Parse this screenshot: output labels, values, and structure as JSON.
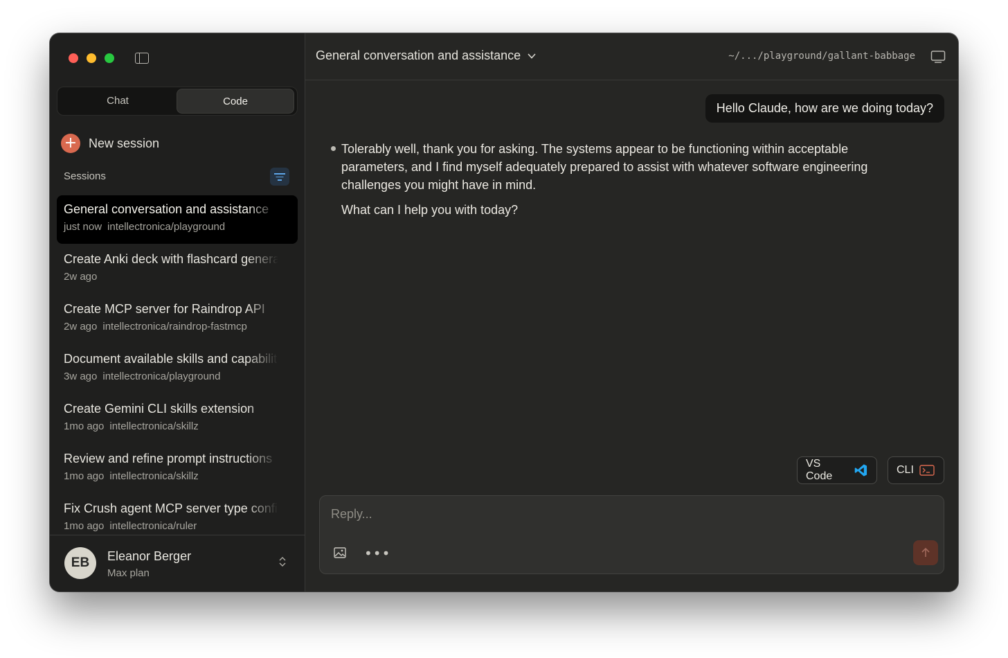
{
  "sidebar": {
    "mode_tabs": [
      {
        "label": "Chat",
        "active": false
      },
      {
        "label": "Code",
        "active": true
      }
    ],
    "new_session_label": "New session",
    "sessions_heading": "Sessions",
    "sessions": [
      {
        "title": "General conversation and assistance",
        "time": "just now",
        "repo": "intellectronica/playground",
        "active": true
      },
      {
        "title": "Create Anki deck with flashcard generator",
        "time": "2w ago",
        "repo": "",
        "active": false
      },
      {
        "title": "Create MCP server for Raindrop API",
        "time": "2w ago",
        "repo": "intellectronica/raindrop-fastmcp",
        "active": false
      },
      {
        "title": "Document available skills and capabilities",
        "time": "3w ago",
        "repo": "intellectronica/playground",
        "active": false
      },
      {
        "title": "Create Gemini CLI skills extension",
        "time": "1mo ago",
        "repo": "intellectronica/skillz",
        "active": false
      },
      {
        "title": "Review and refine prompt instructions",
        "time": "1mo ago",
        "repo": "intellectronica/skillz",
        "active": false
      },
      {
        "title": "Fix Crush agent MCP server type config",
        "time": "1mo ago",
        "repo": "intellectronica/ruler",
        "active": false
      }
    ],
    "profile": {
      "initials": "EB",
      "name": "Eleanor Berger",
      "plan": "Max plan"
    }
  },
  "header": {
    "title": "General conversation and assistance",
    "path": "~/.../playground/gallant-babbage"
  },
  "conversation": {
    "user_message": "Hello Claude, how are we doing today?",
    "assistant_paragraphs": [
      "Tolerably well, thank you for asking. The systems appear to be functioning within acceptable parameters, and I find myself adequately prepared to assist with whatever software engineering challenges you might have in mind.",
      "What can I help you with today?"
    ]
  },
  "actions": {
    "vscode_label": "VS Code",
    "cli_label": "CLI"
  },
  "composer": {
    "placeholder": "Reply...",
    "value": ""
  },
  "colors": {
    "accent": "#d9694f",
    "vscode_blue": "#22a7f2",
    "filter_blue": "#5ea6e8"
  },
  "icons": {
    "sidebar_toggle": "sidebar-toggle-icon",
    "filter": "filter-icon",
    "chevron": "chevron-down-icon",
    "monitor": "monitor-icon",
    "attach": "image-icon",
    "more": "more-icon",
    "send": "arrow-up-icon",
    "vscode": "vscode-icon",
    "terminal": "terminal-icon",
    "updown": "chevron-updown-icon"
  }
}
